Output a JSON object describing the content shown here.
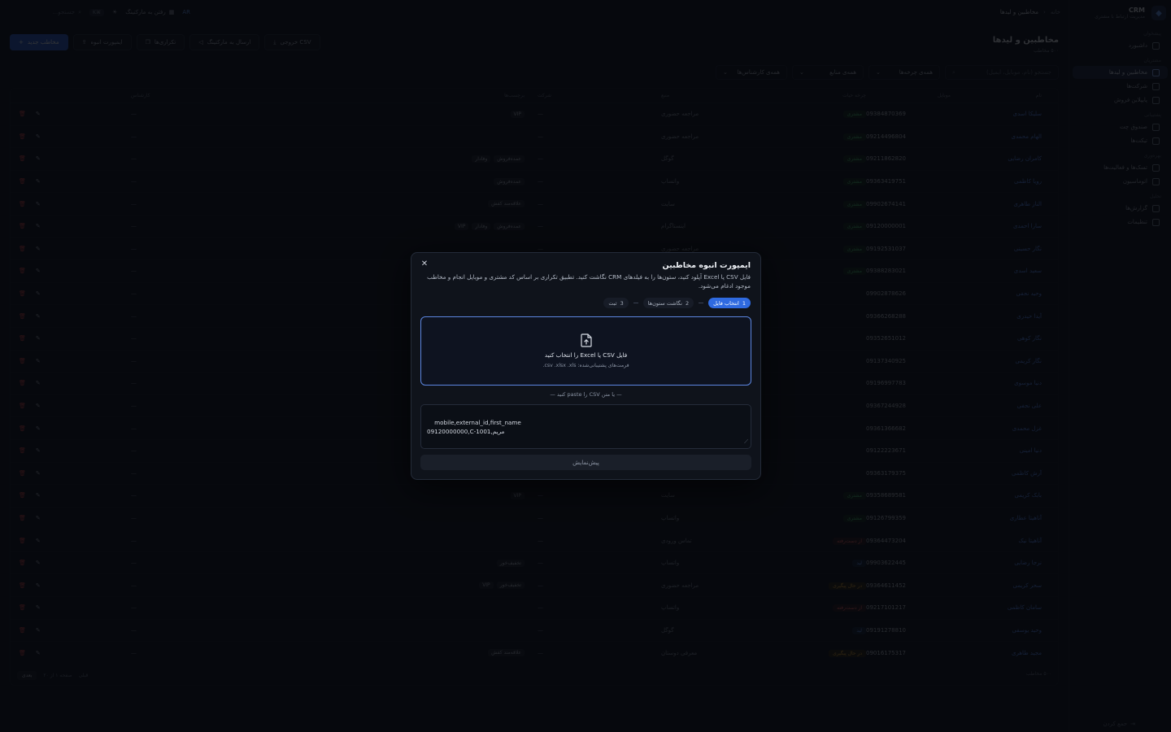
{
  "brand": {
    "title": "CRM",
    "subtitle": "مدیریت ارتباط با مشتری"
  },
  "sidebar": {
    "groups": [
      {
        "label": "پیشخوان",
        "items": [
          {
            "label": "داشبورد",
            "icon": "dashboard-icon"
          }
        ]
      },
      {
        "label": "مشتریان",
        "items": [
          {
            "label": "مخاطبین و لیدها",
            "icon": "users-icon",
            "active": true
          },
          {
            "label": "شرکت‌ها",
            "icon": "building-icon"
          },
          {
            "label": "پایپلاین فروش",
            "icon": "pipeline-icon"
          }
        ]
      },
      {
        "label": "پشتیبانی",
        "items": [
          {
            "label": "صندوق چت",
            "icon": "chat-icon"
          },
          {
            "label": "تیکت‌ها",
            "icon": "ticket-icon"
          }
        ]
      },
      {
        "label": "بهره‌وری",
        "items": [
          {
            "label": "تسک‌ها و فعالیت‌ها",
            "icon": "tasks-icon"
          },
          {
            "label": "اتوماسیون",
            "icon": "automation-icon"
          }
        ]
      },
      {
        "label": "تحلیل",
        "items": [
          {
            "label": "گزارش‌ها",
            "icon": "reports-icon"
          }
        ]
      },
      {
        "label": "",
        "items": [
          {
            "label": "تنظیمات",
            "icon": "settings-icon"
          }
        ]
      }
    ],
    "collapse_label": "جمع کردن"
  },
  "topbar": {
    "breadcrumb": {
      "home": "خانه",
      "current": "مخاطبین و لیدها"
    },
    "search_placeholder": "جستجو...",
    "shortcut": "⌘K",
    "marketing_link": "رفتن به مارکتینگ"
  },
  "header": {
    "title": "مخاطبین و لیدها",
    "subtitle": "۵۰۰ مخاطب",
    "buttons": {
      "new_contact": "مخاطب جدید",
      "bulk_import": "ایمپورت انبوه",
      "duplicates": "تکراری‌ها",
      "send_marketing": "ارسال به مارکتینگ",
      "export_csv": "خروجی CSV"
    }
  },
  "filters": {
    "search_placeholder": "جستجو (نام، موبایل، ایمیل)",
    "lifecycle": "همه‌ی چرخه‌ها",
    "source": "همه‌ی منابع",
    "owner": "همه‌ی کارشناس‌ها"
  },
  "table": {
    "columns": [
      "نام",
      "موبایل",
      "چرخه حیات",
      "منبع",
      "شرکت",
      "برچسب‌ها",
      "کارشناس"
    ],
    "rows": [
      {
        "name": "سلیکا اسدی",
        "mobile": "09384870369",
        "life": "مشتری",
        "lifeColor": "green",
        "source": "مراجعه حضوری",
        "company": "—",
        "tags": [
          "VIP"
        ],
        "owner": "—"
      },
      {
        "name": "الهام محمدی",
        "mobile": "09214496804",
        "life": "مشتری",
        "lifeColor": "green",
        "source": "مراجعه حضوری",
        "company": "—",
        "tags": [],
        "owner": "—"
      },
      {
        "name": "کامران رضایی",
        "mobile": "09211862820",
        "life": "مشتری",
        "lifeColor": "green",
        "source": "گوگل",
        "company": "—",
        "tags": [
          "وفادار",
          "عمده‌فروش"
        ],
        "owner": "—"
      },
      {
        "name": "رویا کاظمی",
        "mobile": "09363419751",
        "life": "مشتری",
        "lifeColor": "green",
        "source": "واتساپ",
        "company": "—",
        "tags": [
          "عمده‌فروش"
        ],
        "owner": "—"
      },
      {
        "name": "الناز طاهری",
        "mobile": "09902674141",
        "life": "مشتری",
        "lifeColor": "green",
        "source": "سایت",
        "company": "—",
        "tags": [
          "علاقه‌مند کفش"
        ],
        "owner": "—"
      },
      {
        "name": "سارا احمدی",
        "mobile": "09120000001",
        "life": "مشتری",
        "lifeColor": "green",
        "source": "اینستاگرام",
        "company": "—",
        "tags": [
          "VIP",
          "وفادار",
          "عمده‌فروش"
        ],
        "owner": "—"
      },
      {
        "name": "نگار حسینی",
        "mobile": "09192531037",
        "life": "مشتری",
        "lifeColor": "green",
        "source": "مراجعه حضوری",
        "company": "—",
        "tags": [],
        "owner": "—"
      },
      {
        "name": "سعید اسدی",
        "mobile": "09388283021",
        "life": "مشتری",
        "lifeColor": "green",
        "source": "",
        "company": "—",
        "tags": [
          "کفش"
        ],
        "owner": "—"
      },
      {
        "name": "وحید نجفی",
        "mobile": "09902878626",
        "life": "",
        "lifeColor": "green",
        "source": "",
        "company": "",
        "tags": [],
        "owner": "—"
      },
      {
        "name": "آیدا حیدری",
        "mobile": "09366268288",
        "life": "",
        "lifeColor": "green",
        "source": "",
        "company": "",
        "tags": [],
        "owner": "—"
      },
      {
        "name": "نگار کوهی",
        "mobile": "09352651012",
        "life": "",
        "lifeColor": "green",
        "source": "",
        "company": "",
        "tags": [],
        "owner": "—"
      },
      {
        "name": "نگار کریمی",
        "mobile": "09137340925",
        "life": "",
        "lifeColor": "green",
        "source": "",
        "company": "",
        "tags": [],
        "owner": "—"
      },
      {
        "name": "دنیا موسوی",
        "mobile": "09196997783",
        "life": "",
        "lifeColor": "green",
        "source": "",
        "company": "",
        "tags": [],
        "owner": "—"
      },
      {
        "name": "علی نجفی",
        "mobile": "09367244928",
        "life": "",
        "lifeColor": "green",
        "source": "",
        "company": "",
        "tags": [],
        "owner": "—"
      },
      {
        "name": "غزل محمدی",
        "mobile": "09361366682",
        "life": "",
        "lifeColor": "green",
        "source": "",
        "company": "",
        "tags": [],
        "owner": "—"
      },
      {
        "name": "دنیا امینی",
        "mobile": "09122223671",
        "life": "",
        "lifeColor": "green",
        "source": "",
        "company": "",
        "tags": [],
        "owner": "—"
      },
      {
        "name": "آرش کاظمی",
        "mobile": "09363179375",
        "life": "",
        "lifeColor": "green",
        "source": "",
        "company": "",
        "tags": [],
        "owner": "—"
      },
      {
        "name": "بابک کریمی",
        "mobile": "09358689581",
        "life": "مشتری",
        "lifeColor": "green",
        "source": "سایت",
        "company": "—",
        "tags": [
          "VIP"
        ],
        "owner": "—"
      },
      {
        "name": "آناهیتا عطاری",
        "mobile": "09126799359",
        "life": "مشتری",
        "lifeColor": "green",
        "source": "واتساپ",
        "company": "—",
        "tags": [],
        "owner": "—"
      },
      {
        "name": "آناهیتا نیک",
        "mobile": "09364473204",
        "life": "از دست‌رفته",
        "lifeColor": "red",
        "source": "تماس ورودی",
        "company": "—",
        "tags": [],
        "owner": "—"
      },
      {
        "name": "نرجا رضایی",
        "mobile": "09903622445",
        "life": "لید",
        "lifeColor": "blue",
        "source": "واتساپ",
        "company": "—",
        "tags": [
          "تخفیف‌خور"
        ],
        "owner": "—"
      },
      {
        "name": "سحر کریمی",
        "mobile": "09364611452",
        "life": "در حال پیگیری",
        "lifeColor": "amber",
        "source": "مراجعه حضوری",
        "company": "—",
        "tags": [
          "VIP",
          "تخفیف‌خور"
        ],
        "owner": "—"
      },
      {
        "name": "سامان کاظمی",
        "mobile": "09217101217",
        "life": "از دست‌رفته",
        "lifeColor": "red",
        "source": "واتساپ",
        "company": "—",
        "tags": [],
        "owner": "—"
      },
      {
        "name": "وحید یوسفی",
        "mobile": "09191278810",
        "life": "لید",
        "lifeColor": "blue",
        "source": "گوگل",
        "company": "—",
        "tags": [],
        "owner": "—"
      },
      {
        "name": "مجید طاهری",
        "mobile": "09016175317",
        "life": "در حال پیگیری",
        "lifeColor": "amber",
        "source": "معرفی دوستان",
        "company": "—",
        "tags": [
          "علاقه‌مند کفش"
        ],
        "owner": "—"
      }
    ],
    "footer": {
      "count": "۵۰۰ مخاطب",
      "prev": "قبلی",
      "page": "صفحه ۱ از ۲۰",
      "next": "بعدی"
    }
  },
  "modal": {
    "title": "ایمپورت انبوه مخاطبین",
    "description": "فایل CSV یا Excel آپلود کنید، ستون‌ها را به فیلدهای CRM نگاشت کنید. تطبیق تکراری بر اساس کد مشتری و موبایل انجام و مخاطب موجود ادغام می‌شود.",
    "steps": [
      {
        "num": "1",
        "label": "انتخاب فایل",
        "active": true
      },
      {
        "num": "2",
        "label": "نگاشت ستون‌ها",
        "active": false
      },
      {
        "num": "3",
        "label": "ثبت",
        "active": false
      }
    ],
    "dropzone_main": "فایل CSV یا Excel را انتخاب کنید",
    "dropzone_sub": "فرمت‌های پشتیبانی‌شده: csv .xlsx .xls.",
    "divider": "— یا متن CSV را paste کنید —",
    "paste_text": "mobile,external_id,first_name\n09120000000,C-1001,مریم",
    "preview_button": "پیش‌نمایش",
    "close_label": "✕"
  }
}
